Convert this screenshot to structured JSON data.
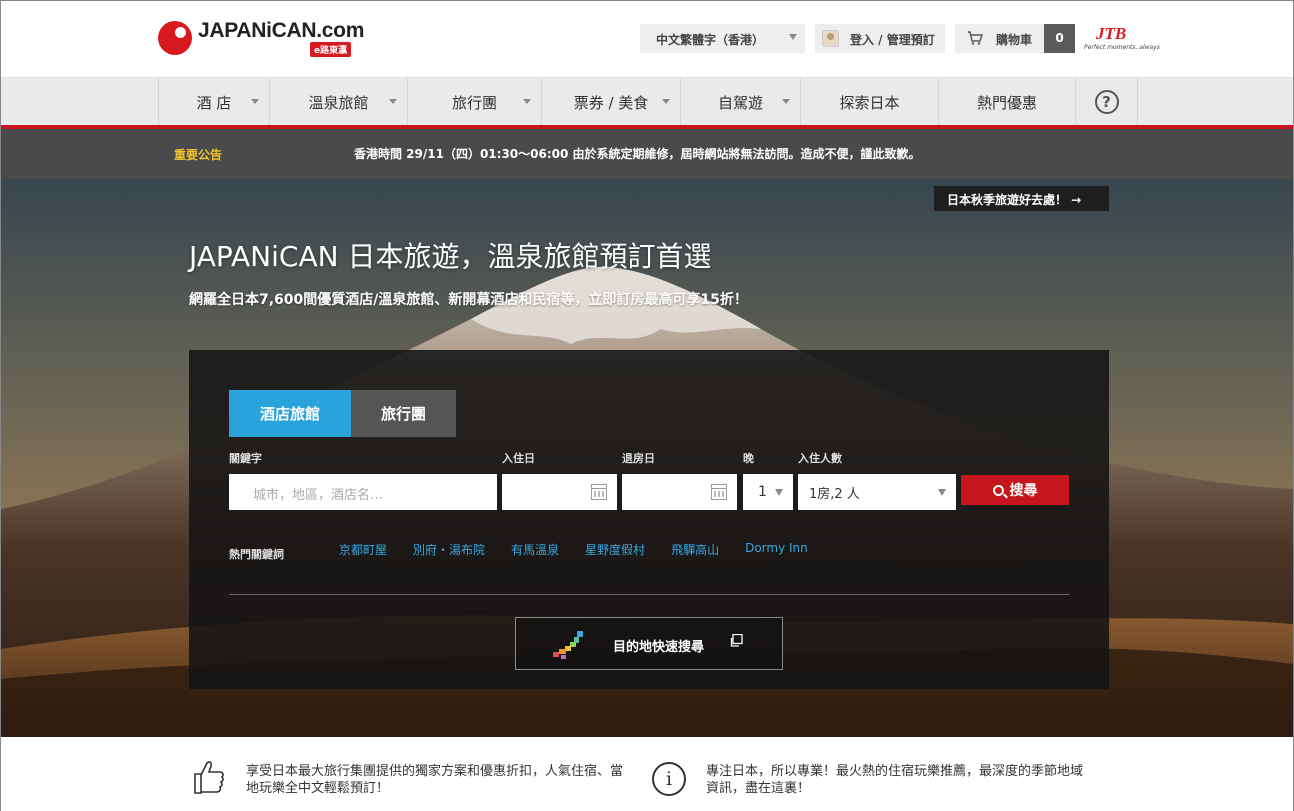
{
  "header": {
    "logo_text": "JAPANiCAN.com",
    "logo_tag": "e路東瀛",
    "language": "中文繁體字（香港）",
    "login": "登入 / 管理預訂",
    "cart_label": "購物車",
    "cart_count": "0",
    "partner_mark": "JTB",
    "partner_tagline": "Perfect moments, always"
  },
  "nav": {
    "items": [
      {
        "label": "酒 店",
        "dropdown": true
      },
      {
        "label": "溫泉旅館",
        "dropdown": true
      },
      {
        "label": "旅行團",
        "dropdown": true
      },
      {
        "label": "票券 / 美食",
        "dropdown": true
      },
      {
        "label": "自駕遊",
        "dropdown": true
      },
      {
        "label": "探索日本",
        "dropdown": false
      },
      {
        "label": "熱門優惠",
        "dropdown": false
      }
    ],
    "help": "?"
  },
  "notice": {
    "label": "重要公告",
    "text": "香港時間 29/11（四）01:30～06:00 由於系統定期維修，屆時網站將無法訪問。造成不便，謹此致歉。"
  },
  "hero": {
    "promo_link": "日本秋季旅遊好去處！ →",
    "title": "JAPANiCAN 日本旅遊，溫泉旅館預訂首選",
    "subtitle": "網羅全日本7,600間優質酒店/溫泉旅館、新開幕酒店和民宿等，立即訂房最高可享15折！"
  },
  "search": {
    "tabs": [
      "酒店旅館",
      "旅行團"
    ],
    "active_tab": "酒店旅館",
    "labels": {
      "keyword": "關鍵字",
      "checkin": "入住日",
      "checkout": "退房日",
      "nights": "晚",
      "guests": "入住人數"
    },
    "keyword_placeholder": "城市，地區，酒店名…",
    "nights_value": "1",
    "guests_value": "1房,2 人",
    "button": "搜尋",
    "hot_label": "熱門關鍵詞",
    "hot_keywords": [
      "京都町屋",
      "別府・湯布院",
      "有馬溫泉",
      "星野度假村",
      "飛驒高山",
      "Dormy Inn"
    ],
    "destination_button": "目的地快速搜尋"
  },
  "features": [
    {
      "icon": "thumbs-up-icon",
      "text": "享受日本最大旅行集團提供的獨家方案和優惠折扣，人氣住宿、當地玩樂全中文輕鬆預訂！"
    },
    {
      "icon": "info-icon",
      "text": "專注日本，所以專業！最火熱的住宿玩樂推薦，最深度的季節地域資訊，盡在這裏！"
    }
  ],
  "colors": {
    "brand_red": "#c4161c",
    "tab_blue": "#2aa3dc",
    "link_blue": "#3aa7e0",
    "notice_yellow": "#f1c232"
  }
}
